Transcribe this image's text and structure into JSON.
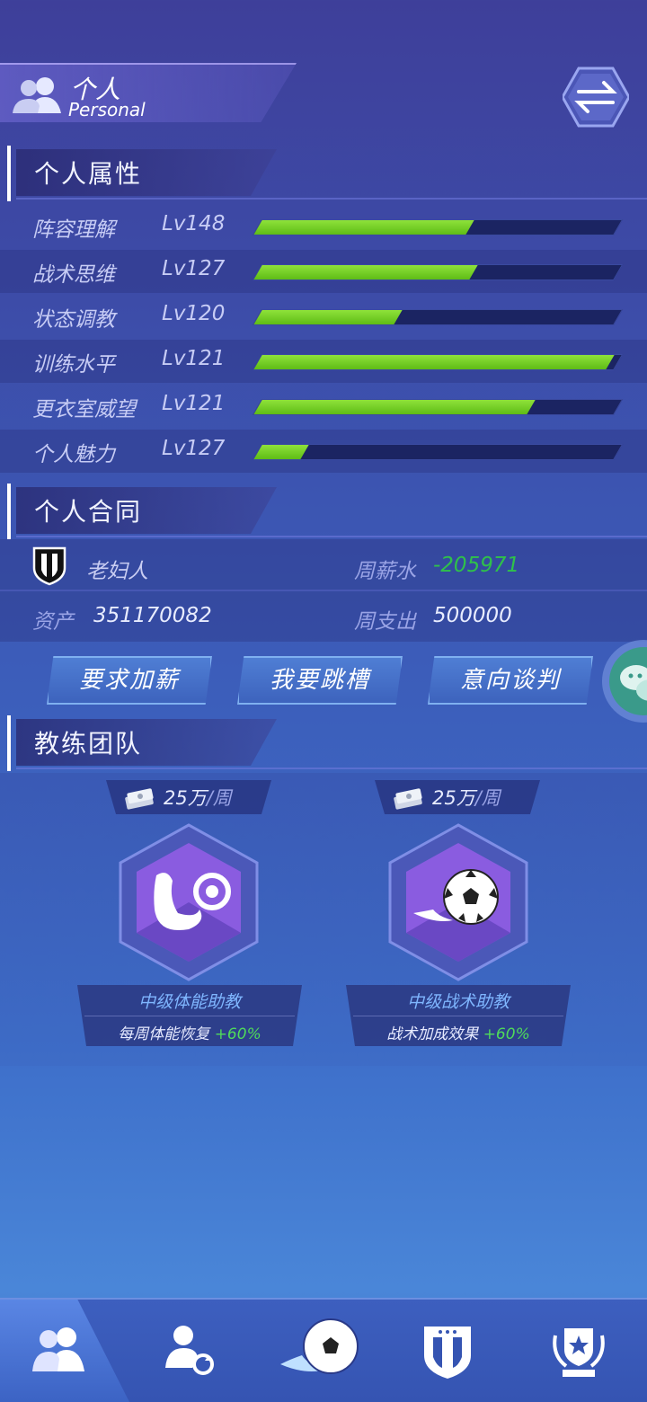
{
  "header": {
    "title": "个人",
    "subtitle": "Personal",
    "icon": "people-icon",
    "switch_icon": "swap-arrows-icon"
  },
  "sections": {
    "attributes": "个人属性",
    "contract": "个人合同",
    "coach_team": "教练团队"
  },
  "attributes": [
    {
      "name": "阵容理解",
      "level": "Lv148",
      "progress": 0.59
    },
    {
      "name": "战术思维",
      "level": "Lv127",
      "progress": 0.6
    },
    {
      "name": "状态调教",
      "level": "Lv120",
      "progress": 0.39
    },
    {
      "name": "训练水平",
      "level": "Lv121",
      "progress": 0.98
    },
    {
      "name": "更衣室威望",
      "level": "Lv121",
      "progress": 0.76
    },
    {
      "name": "个人魅力",
      "level": "Lv127",
      "progress": 0.13
    }
  ],
  "contract": {
    "club_name": "老妇人",
    "weekly_salary_label": "周薪水",
    "weekly_salary_value": "-205971",
    "assets_label": "资产",
    "assets_value": "351170082",
    "weekly_expense_label": "周支出",
    "weekly_expense_value": "500000"
  },
  "actions": {
    "raise": "要求加薪",
    "transfer": "我要跳槽",
    "negotiate": "意向谈判"
  },
  "coaches": [
    {
      "cost_num": "25万",
      "cost_unit": "/周",
      "role": "中级体能助教",
      "effect": "每周体能恢复",
      "bonus": "+60%",
      "icon": "fitness-arm-icon"
    },
    {
      "cost_num": "25万",
      "cost_unit": "/周",
      "role": "中级战术助教",
      "effect": "战术加成效果",
      "bonus": "+60%",
      "icon": "soccer-ball-icon"
    }
  ],
  "colors": {
    "progress_fill": "#6ccb22",
    "positive_green": "#4fdb5a",
    "salary_green": "#2fc14a",
    "role_blue": "#7fb6ff"
  },
  "nav": [
    "people-icon",
    "player-swap-icon",
    "soccer-ball-icon",
    "team-badge-icon",
    "trophy-icon"
  ]
}
